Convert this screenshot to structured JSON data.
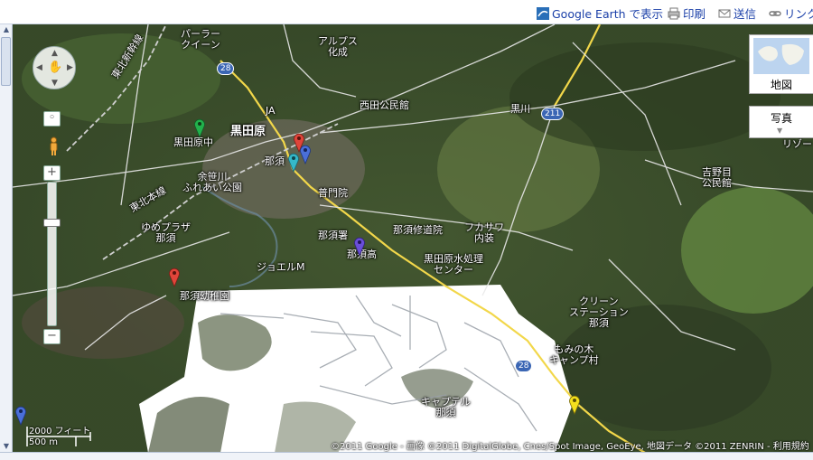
{
  "toolbar": {
    "google_earth": "Google Earth で表示",
    "print": "印刷",
    "send": "送信",
    "link": "リンク"
  },
  "map": {
    "labels": {
      "parlor_queen": "パーラー\nクイーン",
      "alps_kasei": "アルプス\n化成",
      "tohoku_shinkansen": "東北新幹線",
      "kurodahara": "黒田原",
      "ja": "JA",
      "nishida_kouminkan": "西田公民館",
      "kurokawa": "黒川",
      "kurodahara_jr_hs": "黒田原中",
      "nasu_station_area": "那須",
      "yosasagawa_park": "余笹川\nふれあい公園",
      "fumonin": "普門院",
      "tohoku_main_line": "東北本線",
      "yume_plaza": "ゆめプラザ\n那須",
      "nasu_police": "那須署",
      "nasu_shuudouin": "那須修道院",
      "fukasawa": "フカサワ\n内装",
      "nasu_high": "那須高",
      "jyoeru": "ジョエルM",
      "water_plant": "黒田原水処理\nセンター",
      "nasu_kindergarten": "那須幼稚園",
      "yoshinome": "吉野目\n公民館",
      "riso": "リゾー",
      "clean_station": "クリーン\nステーション\n那須",
      "momi_camp": "もみの木\nキャンプ村",
      "capital_nasu": "キャプテル\n那須"
    },
    "routes": {
      "r28_top": "28",
      "r211": "211",
      "r28_bottom": "28"
    },
    "map_type": {
      "map_label": "地図",
      "photo_label": "写真"
    },
    "scale": {
      "feet": "2000 フィート",
      "meters": "500 m"
    },
    "copyright": "©2011 Google - 画像 ©2011 DigitalGlobe, Cnes/Spot Image, GeoEye, 地図データ ©2011 ZENRIN - 利用規約",
    "pin_colors": {
      "green": "#22b14c",
      "red": "#e0453a",
      "blue": "#4a6fd8",
      "cyan": "#35b8c9",
      "purple": "#6a4fd8",
      "yellow": "#f4e01e"
    }
  }
}
